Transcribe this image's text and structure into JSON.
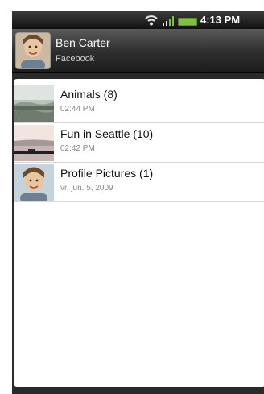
{
  "status_bar": {
    "time": "4:13 PM",
    "icons": [
      "wifi-icon",
      "signal-icon",
      "battery-icon"
    ],
    "battery_color": "#7ec142"
  },
  "header": {
    "name": "Ben Carter",
    "source": "Facebook"
  },
  "albums": [
    {
      "title": "Animals (8)",
      "subtitle": "02:44 PM",
      "thumbnail": "animals-photo"
    },
    {
      "title": "Fun in Seattle (10)",
      "subtitle": "02:42 PM",
      "thumbnail": "seattle-photo"
    },
    {
      "title": "Profile Pictures (1)",
      "subtitle": "vr, jun. 5, 2009",
      "thumbnail": "profile-photo"
    }
  ]
}
